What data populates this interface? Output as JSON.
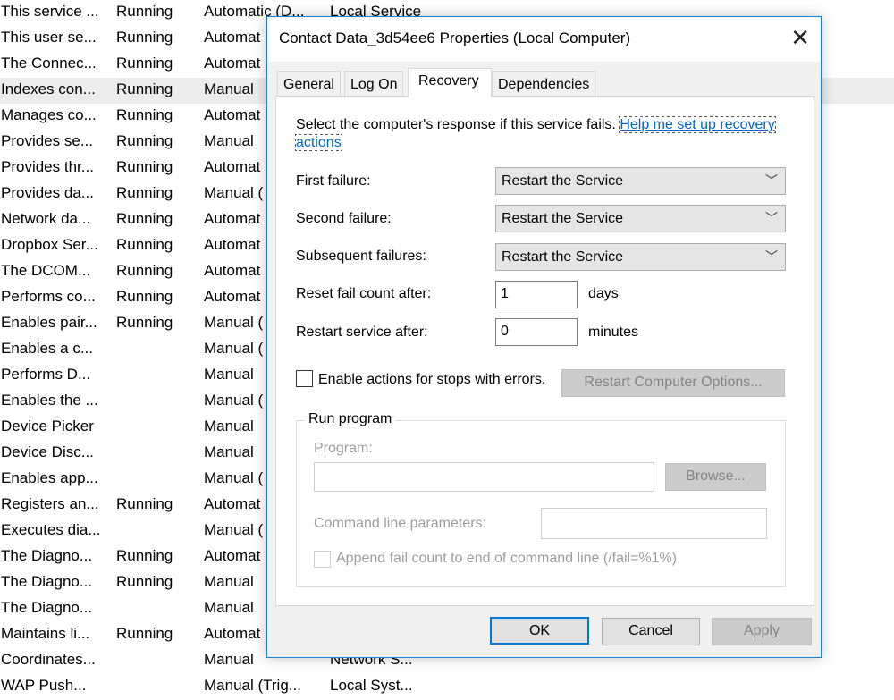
{
  "services": [
    {
      "description": "This service ...",
      "status": "Running",
      "startup": "Automatic (D...",
      "logon": "Local Service"
    },
    {
      "description": "This user se...",
      "status": "Running",
      "startup": "Automat",
      "logon": ""
    },
    {
      "description": "The Connec...",
      "status": "Running",
      "startup": "Automat",
      "logon": ""
    },
    {
      "description": "Indexes con...",
      "status": "Running",
      "startup": "Manual",
      "logon": "",
      "selected": true
    },
    {
      "description": "Manages co...",
      "status": "Running",
      "startup": "Automat",
      "logon": ""
    },
    {
      "description": "Provides se...",
      "status": "Running",
      "startup": "Manual",
      "logon": ""
    },
    {
      "description": "Provides thr...",
      "status": "Running",
      "startup": "Automat",
      "logon": ""
    },
    {
      "description": "Provides da...",
      "status": "Running",
      "startup": "Manual (",
      "logon": ""
    },
    {
      "description": "Network da...",
      "status": "Running",
      "startup": "Automat",
      "logon": ""
    },
    {
      "description": "Dropbox Ser...",
      "status": "Running",
      "startup": "Automat",
      "logon": ""
    },
    {
      "description": "The DCOM...",
      "status": "Running",
      "startup": "Automat",
      "logon": ""
    },
    {
      "description": "Performs co...",
      "status": "Running",
      "startup": "Automat",
      "logon": ""
    },
    {
      "description": "Enables pair...",
      "status": "Running",
      "startup": "Manual (",
      "logon": ""
    },
    {
      "description": "Enables a c...",
      "status": "",
      "startup": "Manual (",
      "logon": ""
    },
    {
      "description": "Performs D...",
      "status": "",
      "startup": "Manual",
      "logon": ""
    },
    {
      "description": "Enables the ...",
      "status": "",
      "startup": "Manual (",
      "logon": ""
    },
    {
      "description": "Device Picker",
      "status": "",
      "startup": "Manual",
      "logon": ""
    },
    {
      "description": "Device Disc...",
      "status": "",
      "startup": "Manual",
      "logon": ""
    },
    {
      "description": "Enables app...",
      "status": "",
      "startup": "Manual (",
      "logon": ""
    },
    {
      "description": "Registers an...",
      "status": "Running",
      "startup": "Automat",
      "logon": ""
    },
    {
      "description": "Executes dia...",
      "status": "",
      "startup": "Manual (",
      "logon": ""
    },
    {
      "description": "The Diagno...",
      "status": "Running",
      "startup": "Automat",
      "logon": ""
    },
    {
      "description": "The Diagno...",
      "status": "Running",
      "startup": "Manual",
      "logon": ""
    },
    {
      "description": "The Diagno...",
      "status": "",
      "startup": "Manual",
      "logon": ""
    },
    {
      "description": "Maintains li...",
      "status": "Running",
      "startup": "Automat",
      "logon": ""
    },
    {
      "description": "Coordinates...",
      "status": "",
      "startup": "Manual",
      "logon": "Network S..."
    },
    {
      "description": "WAP Push...",
      "status": "",
      "startup": "Manual (Trig...",
      "logon": "Local Syst..."
    }
  ],
  "dialog": {
    "title": "Contact Data_3d54ee6 Properties (Local Computer)",
    "close_icon": "close-icon",
    "tabs": [
      {
        "label": "General"
      },
      {
        "label": "Log On"
      },
      {
        "label": "Recovery",
        "active": true
      },
      {
        "label": "Dependencies"
      }
    ],
    "intro": "Select the computer's response if this service fails.",
    "help_link": "Help me set up recovery actions",
    "first_failure_label": "First failure:",
    "first_failure_value": "Restart the Service",
    "second_failure_label": "Second failure:",
    "second_failure_value": "Restart the Service",
    "subsequent_label": "Subsequent failures:",
    "subsequent_value": "Restart the Service",
    "reset_label": "Reset fail count after:",
    "reset_value": "1",
    "reset_unit": "days",
    "restart_label": "Restart service after:",
    "restart_value": "0",
    "restart_unit": "minutes",
    "enable_actions_label": "Enable actions for stops with errors.",
    "enable_actions_checked": false,
    "restart_computer_button": "Restart Computer Options...",
    "run_program_group": "Run program",
    "program_label": "Program:",
    "program_value": "",
    "browse_button": "Browse...",
    "cmd_label": "Command line parameters:",
    "cmd_value": "",
    "append_label": "Append fail count to end of command line (/fail=%1%)",
    "append_checked": false,
    "ok": "OK",
    "cancel": "Cancel",
    "apply": "Apply"
  },
  "colors": {
    "accent": "#0078d7",
    "link": "#0066cc",
    "dialog_bg": "#f0f0f0"
  }
}
